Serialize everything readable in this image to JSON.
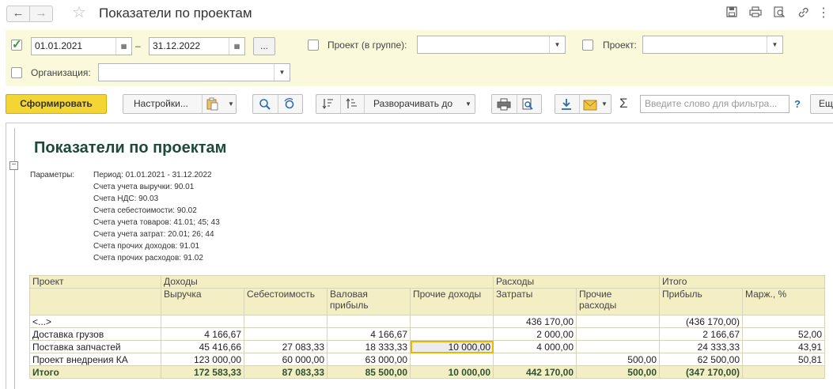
{
  "window": {
    "title": "Показатели по проектам"
  },
  "filters": {
    "date_from": "01.01.2021",
    "date_to": "31.12.2022",
    "dash": "–",
    "more_button": "...",
    "project_group_label": "Проект (в группе):",
    "project_group_value": "",
    "project_label": "Проект:",
    "project_value": "",
    "org_label": "Организация:",
    "org_value": ""
  },
  "toolbar": {
    "generate": "Сформировать",
    "settings": "Настройки...",
    "expand_to": "Разворачивать до",
    "search_placeholder": "Введите слово для фильтра...",
    "help": "?",
    "more": "Ещ"
  },
  "report": {
    "title": "Показатели по проектам",
    "params_label": "Параметры:",
    "params": [
      "Период: 01.01.2021 - 31.12.2022",
      "Счета учета выручки: 90.01",
      "Счета НДС: 90.03",
      "Счета себестоимости: 90.02",
      "Счета учета товаров: 41.01; 45; 43",
      "Счета учета затрат: 20.01; 26; 44",
      "Счета прочих доходов: 91.01",
      "Счета прочих расходов: 91.02"
    ],
    "header_top": {
      "project": "Проект",
      "income": "Доходы",
      "expenses": "Расходы",
      "total": "Итого"
    },
    "header_sub": {
      "revenue": "Выручка",
      "cost": "Себестоимость",
      "gross_1": "Валовая",
      "gross_2": "прибыль",
      "other_income": "Прочие доходы",
      "costs": "Затраты",
      "other_exp_1": "Прочие",
      "other_exp_2": "расходы",
      "profit": "Прибыль",
      "margin": "Марж., %"
    },
    "rows": [
      {
        "project": "<...>",
        "revenue": "",
        "cost": "",
        "gross": "",
        "other_income": "",
        "costs": "436 170,00",
        "other_exp": "",
        "profit": "(436 170,00)",
        "margin": ""
      },
      {
        "project": "Доставка грузов",
        "revenue": "4 166,67",
        "cost": "",
        "gross": "4 166,67",
        "other_income": "",
        "costs": "2 000,00",
        "other_exp": "",
        "profit": "2 166,67",
        "margin": "52,00"
      },
      {
        "project": "Поставка запчастей",
        "revenue": "45 416,66",
        "cost": "27 083,33",
        "gross": "18 333,33",
        "other_income": "10 000,00",
        "costs": "4 000,00",
        "other_exp": "",
        "profit": "24 333,33",
        "margin": "43,91"
      },
      {
        "project": "Проект внедрения КА",
        "revenue": "123 000,00",
        "cost": "60 000,00",
        "gross": "63 000,00",
        "other_income": "",
        "costs": "",
        "other_exp": "500,00",
        "profit": "62 500,00",
        "margin": "50,81"
      }
    ],
    "total": {
      "project": "Итого",
      "revenue": "172 583,33",
      "cost": "87 083,33",
      "gross": "85 500,00",
      "other_income": "10 000,00",
      "costs": "442 170,00",
      "other_exp": "500,00",
      "profit": "(347 170,00)",
      "margin": ""
    }
  }
}
